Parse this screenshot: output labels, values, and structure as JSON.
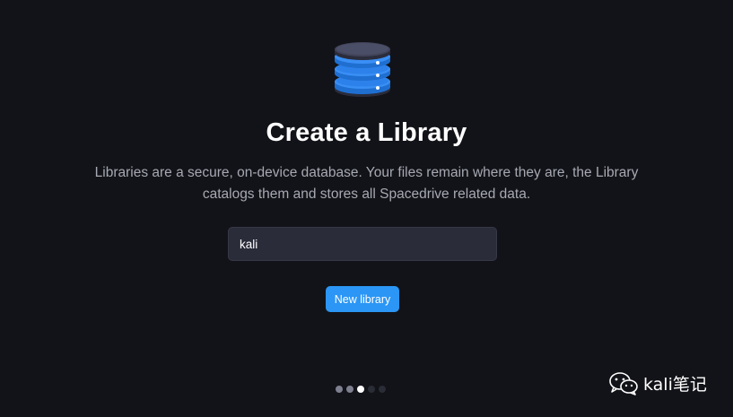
{
  "onboarding": {
    "title": "Create a Library",
    "description": "Libraries are a secure, on-device database. Your files remain where they are, the Library catalogs them and stores all Spacedrive related data.",
    "library_name_value": "kali",
    "submit_label": "New library",
    "steps": {
      "total": 5,
      "current": 3
    },
    "icon": "database-icon"
  },
  "watermark": {
    "text": "kali笔记",
    "icon": "wechat-icon"
  },
  "colors": {
    "background": "#121318",
    "accent": "#2b96f5",
    "input_bg": "#2a2c39",
    "muted_text": "#a7a9b3"
  }
}
